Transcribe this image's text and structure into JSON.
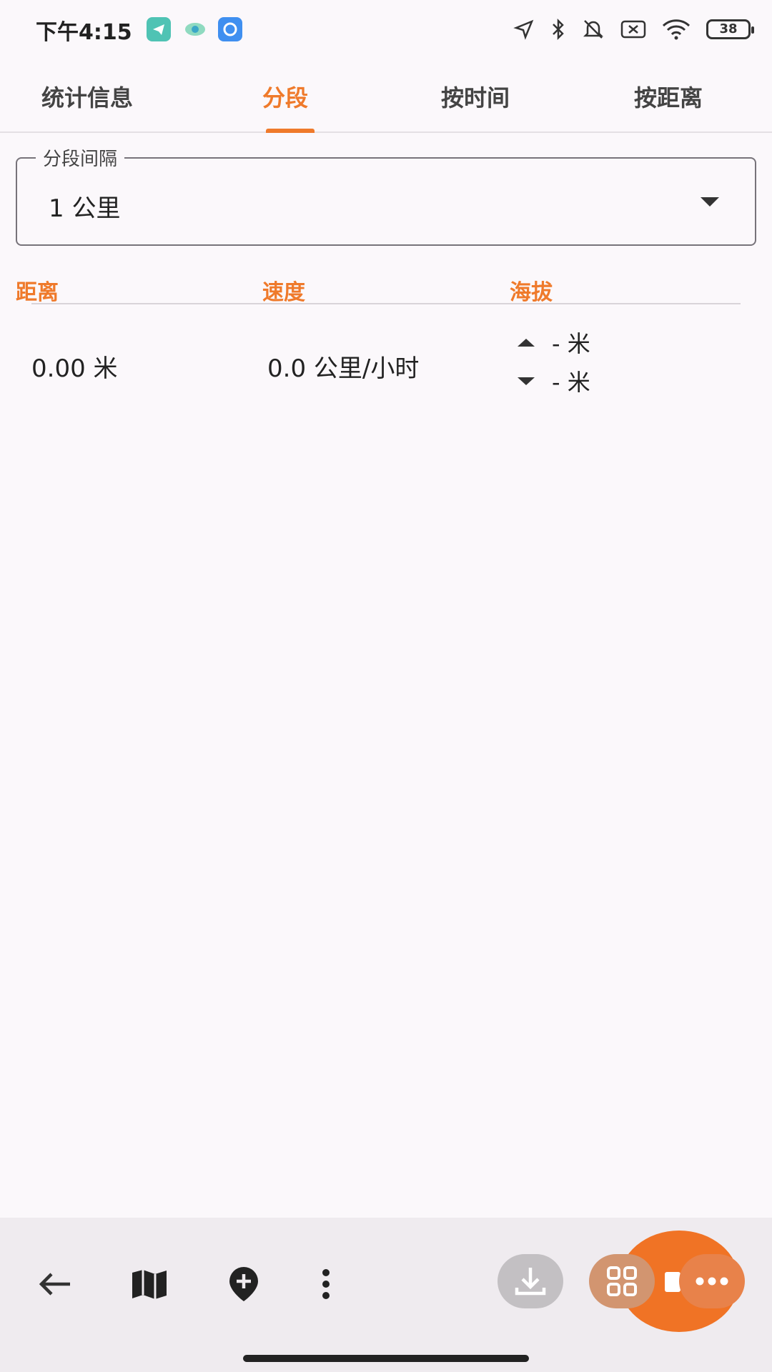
{
  "status_bar": {
    "time": "下午4:15",
    "battery": "38",
    "icons": [
      "telegram-icon",
      "eye-app-icon",
      "app-icon",
      "location-arrow-icon",
      "bluetooth-icon",
      "bell-muted-icon",
      "no-sim-icon",
      "wifi-icon",
      "battery-icon"
    ]
  },
  "tabs": [
    {
      "label": "统计信息",
      "active": false
    },
    {
      "label": "分段",
      "active": true
    },
    {
      "label": "按时间",
      "active": false
    },
    {
      "label": "按距离",
      "active": false
    }
  ],
  "interval_field": {
    "label": "分段间隔",
    "value": "1 公里"
  },
  "table": {
    "headers": [
      "距离",
      "速度",
      "海拔"
    ],
    "rows": [
      {
        "distance": "0.00 米",
        "speed": "0.0 公里/小时",
        "elev_up": "- 米",
        "elev_down": "- 米"
      }
    ]
  },
  "bottom_bar": {
    "buttons": [
      "back-arrow-icon",
      "map-icon",
      "add-place-icon",
      "more-vert-icon",
      "download-icon",
      "grid-icon",
      "stop-icon",
      "more-horiz-icon"
    ]
  },
  "colors": {
    "accent": "#ef7a2b",
    "background": "#fbf8fb",
    "bottom_bar": "#efebef"
  }
}
